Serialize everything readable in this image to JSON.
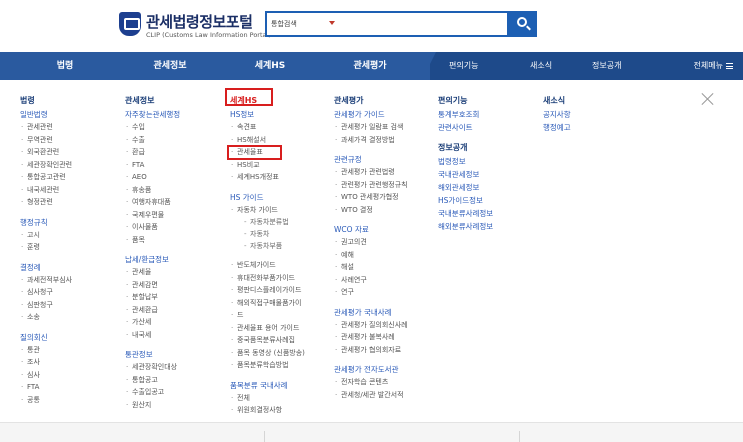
{
  "header": {
    "title": "관세법령정보포털",
    "subtitle": "CLIP (Customs Law Information Portal)",
    "search_select": "통합검색",
    "search_placeholder": ""
  },
  "nav": {
    "left": [
      "법령",
      "관세정보",
      "세계HS",
      "관세평가"
    ],
    "right": [
      "편의기능",
      "새소식",
      "정보공개"
    ],
    "all_menu": "전체메뉴"
  },
  "menu": {
    "col1": {
      "title": "법령",
      "sections": [
        {
          "label": "일반법령",
          "items": [
            "관세관련",
            "무역관련",
            "외국환관련",
            "세관장확인관련",
            "통합공고관련",
            "내국세관련",
            "형정관련"
          ]
        },
        {
          "label": "행정규칙",
          "items": [
            "고시",
            "훈령"
          ]
        },
        {
          "label": "결정례",
          "items": [
            "과세전적부심사",
            "심사청구",
            "심판청구",
            "소송"
          ]
        },
        {
          "label": "질의회신",
          "items": [
            "통관",
            "조사",
            "심사",
            "FTA",
            "공통"
          ]
        }
      ]
    },
    "col2": {
      "title": "관세정보",
      "sections": [
        {
          "label": "자주찾는관세행정",
          "items": [
            "수입",
            "수출",
            "환급",
            "FTA",
            "AEO",
            "휴송품",
            "여행자휴대품",
            "국제우편물",
            "이사물품",
            "품목"
          ]
        },
        {
          "label": "납세/환급정보",
          "items": [
            "관세율",
            "관세감면",
            "분할납부",
            "관세환급",
            "가산세",
            "내국세"
          ]
        },
        {
          "label": "통관정보",
          "items": [
            "세관장확인대상",
            "통합공고",
            "수출입공고",
            "원산지"
          ]
        }
      ]
    },
    "col3": {
      "title": "세계HS",
      "sections": [
        {
          "label": "HS정보",
          "items": [
            "속견표",
            "HS해설서",
            "관세율표",
            "HS비교",
            "세계HS개정표"
          ],
          "subs": []
        },
        {
          "label": "HS 가이드",
          "items": [
            "자동차 가이드"
          ],
          "subs": [
            "자동차분류법",
            "자동차",
            "자동차부품"
          ]
        }
      ],
      "more_items": [
        "반도체가이드",
        "휴대전화부품가이드",
        "평판디스플레이가이드",
        "해외직접구매물품가이",
        "드",
        "관세율표 용어 가이드",
        "중국품목분류사례집",
        "품목 동영상 (신품방송)",
        "품목분류학습방법"
      ],
      "section3": {
        "label": "품목분류 국내사례",
        "items": [
          "전체",
          "위원회결정사항"
        ]
      }
    },
    "col4": {
      "title": "관세평가",
      "sections": [
        {
          "label": "관세평가 가이드",
          "items": [
            "관세평가 일람표 검색",
            "과세가격 결정방법"
          ]
        },
        {
          "label": "관련규정",
          "items": [
            "관세평가 관련법령",
            "관련평가 관련행정규칙",
            "WTO 관세평가협정",
            "WTO 결정"
          ]
        },
        {
          "label": "WCO 자료",
          "items": [
            "권고의견",
            "예해",
            "해설",
            "사례연구",
            "연구"
          ]
        },
        {
          "label": "관세평가 국내사례",
          "items": [
            "관세평가 질의회신사례",
            "관세평가 불복사례",
            "관세평가 협의회자료"
          ]
        },
        {
          "label": "관세평가 전자도서관",
          "items": [
            "전자학습 콘텐츠",
            "관세청/세관 발간서적"
          ]
        }
      ]
    },
    "col5": {
      "title": "편의기능",
      "links": [
        "통계부호조회",
        "관련사이트"
      ],
      "title2": "정보공개",
      "links2": [
        "법령정보",
        "국내관세정보",
        "해외관세정보",
        "HS가이드정보",
        "국내분류사례정보",
        "해외분류사례정보"
      ]
    },
    "col6": {
      "title": "새소식",
      "links": [
        "공지사항",
        "행정예고"
      ]
    }
  },
  "colors": {
    "nav_bg": "#1e4a8a",
    "accent_blue": "#1d5fb3",
    "highlight_red": "#d81e1e"
  }
}
